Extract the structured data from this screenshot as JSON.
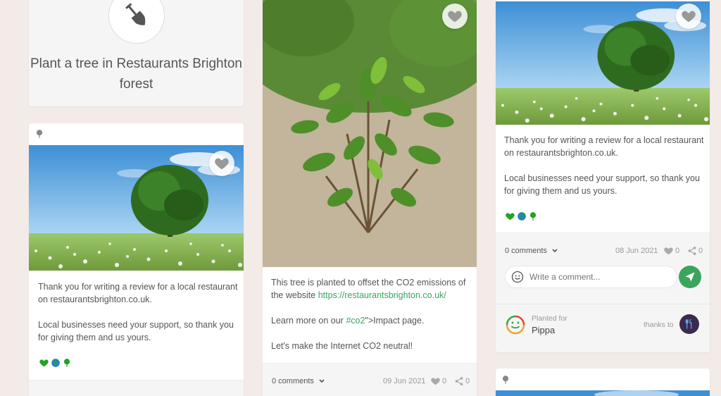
{
  "title_card": {
    "title": "Plant a tree in Restaurants Brighton forest"
  },
  "card_left": {
    "text1": "Thank you for writing a review for a local restaurant on restaurantsbrighton.co.uk.",
    "text2": "Local businesses need your support, so thank you for giving them and us yours."
  },
  "card_middle": {
    "text1_pre": "This tree is planted to offset the CO2 emissions of the website ",
    "text1_link": "https://restaurantsbrighton.co.uk/",
    "text2_pre": "Learn more on our ",
    "text2_link": "#co2",
    "text2_post": "\">Impact page.",
    "text3": "Let's make the Internet CO2 neutral!",
    "comments": "0 comments",
    "date": "09 Jun 2021",
    "likes": "0",
    "shares": "0"
  },
  "card_right": {
    "text1": "Thank you for writing a review for a local restaurant on restaurantsbrighton.co.uk.",
    "text2": "Local businesses need your support, so thank you for giving them and us yours.",
    "comments": "0 comments",
    "date": "08 Jun 2021",
    "likes": "0",
    "shares": "0",
    "comment_placeholder": "Write a comment...",
    "planted_for_label": "Planted for",
    "planted_for_name": "Pippa",
    "thanks_to": "thanks to"
  },
  "colors": {
    "accent": "#3aa55d",
    "background": "#f3ebe8"
  },
  "icons": [
    "shovel-icon",
    "heart-icon",
    "tree-icon",
    "chevron-down-icon",
    "share-icon",
    "smiley-icon",
    "send-icon",
    "fork-knife-icon"
  ]
}
